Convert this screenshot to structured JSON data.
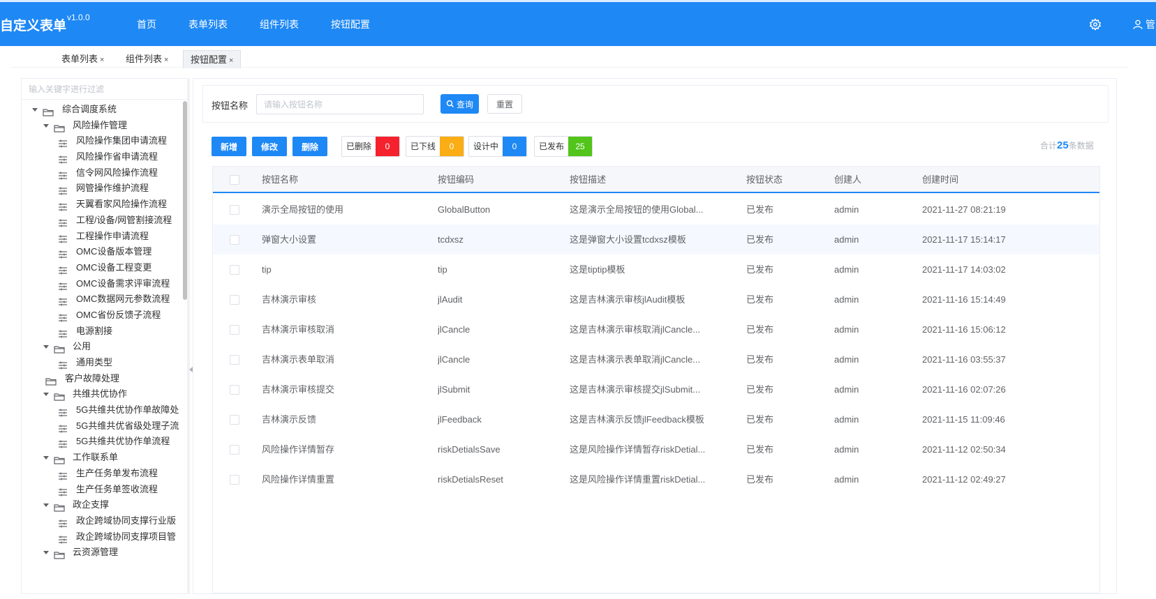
{
  "app": {
    "title": "自定义表单",
    "version": "v1.0.0"
  },
  "nav": [
    "首页",
    "表单列表",
    "组件列表",
    "按钮配置"
  ],
  "user": {
    "label": "管"
  },
  "tabs": [
    {
      "label": "表单列表",
      "close": "×"
    },
    {
      "label": "组件列表",
      "close": "×"
    },
    {
      "label": "按钮配置",
      "close": "×"
    }
  ],
  "sidebar": {
    "filter_placeholder": "输入关键字进行过滤",
    "tree": [
      {
        "label": "综合调度系统",
        "type": "folder",
        "level": 0,
        "caret": true
      },
      {
        "label": "风险操作管理",
        "type": "folder",
        "level": 1,
        "caret": true
      },
      {
        "label": "风险操作集团申请流程",
        "type": "leaf",
        "level": 2
      },
      {
        "label": "风险操作省申请流程",
        "type": "leaf",
        "level": 2
      },
      {
        "label": "信令网风险操作流程",
        "type": "leaf",
        "level": 2
      },
      {
        "label": "网管操作维护流程",
        "type": "leaf",
        "level": 2
      },
      {
        "label": "天翼看家风险操作流程",
        "type": "leaf",
        "level": 2
      },
      {
        "label": "工程/设备/网管割接流程",
        "type": "leaf",
        "level": 2
      },
      {
        "label": "工程操作申请流程",
        "type": "leaf",
        "level": 2
      },
      {
        "label": "OMC设备版本管理",
        "type": "leaf",
        "level": 2
      },
      {
        "label": "OMC设备工程变更",
        "type": "leaf",
        "level": 2
      },
      {
        "label": "OMC设备需求评审流程",
        "type": "leaf",
        "level": 2
      },
      {
        "label": "OMC数据网元参数流程",
        "type": "leaf",
        "level": 2
      },
      {
        "label": "OMC省份反馈子流程",
        "type": "leaf",
        "level": 2
      },
      {
        "label": "电源割接",
        "type": "leaf",
        "level": 2
      },
      {
        "label": "公用",
        "type": "folder",
        "level": 1,
        "caret": true
      },
      {
        "label": "通用类型",
        "type": "leaf",
        "level": 2
      },
      {
        "label": "客户故障处理",
        "type": "folder",
        "level": 1,
        "caret": false
      },
      {
        "label": "共维共优协作",
        "type": "folder",
        "level": 1,
        "caret": true
      },
      {
        "label": "5G共维共优协作单故障处",
        "type": "leaf",
        "level": 2
      },
      {
        "label": "5G共维共优省级处理子流",
        "type": "leaf",
        "level": 2
      },
      {
        "label": "5G共维共优协作单流程",
        "type": "leaf",
        "level": 2
      },
      {
        "label": "工作联系单",
        "type": "folder",
        "level": 1,
        "caret": true
      },
      {
        "label": "生产任务单发布流程",
        "type": "leaf",
        "level": 2
      },
      {
        "label": "生产任务单签收流程",
        "type": "leaf",
        "level": 2
      },
      {
        "label": "政企支撑",
        "type": "folder",
        "level": 1,
        "caret": true
      },
      {
        "label": "政企跨域协同支撑行业版",
        "type": "leaf",
        "level": 2
      },
      {
        "label": "政企跨域协同支撑项目管",
        "type": "leaf",
        "level": 2
      },
      {
        "label": "云资源管理",
        "type": "folder",
        "level": 1,
        "caret": true
      }
    ]
  },
  "search": {
    "label": "按钮名称",
    "placeholder": "请输入按钮名称",
    "query_label": "查询",
    "reset_label": "重置"
  },
  "toolbar": {
    "add_label": "新增",
    "edit_label": "修改",
    "delete_label": "删除"
  },
  "stats": [
    {
      "label": "已删除",
      "count": "0",
      "color": "#f5222d"
    },
    {
      "label": "已下线",
      "count": "0",
      "color": "#faad14"
    },
    {
      "label": "设计中",
      "count": "0",
      "color": "#1e88f5"
    },
    {
      "label": "已发布",
      "count": "25",
      "color": "#52c41a"
    }
  ],
  "total": {
    "prefix": "合计",
    "count": "25",
    "suffix": "条数据"
  },
  "table": {
    "columns": [
      "按钮名称",
      "按钮编码",
      "按钮描述",
      "按钮状态",
      "创建人",
      "创建时间"
    ],
    "rows": [
      [
        "演示全局按钮的使用",
        "GlobalButton",
        "这是演示全局按钮的使用Global...",
        "已发布",
        "admin",
        "2021-11-27 08:21:19"
      ],
      [
        "弹窗大小设置",
        "tcdxsz",
        "这是弹窗大小设置tcdxsz模板",
        "已发布",
        "admin",
        "2021-11-17 15:14:17"
      ],
      [
        "tip",
        "tip",
        "这是tiptip模板",
        "已发布",
        "admin",
        "2021-11-17 14:03:02"
      ],
      [
        "吉林演示审核",
        "jlAudit",
        "这是吉林演示审核jlAudit模板",
        "已发布",
        "admin",
        "2021-11-16 15:14:49"
      ],
      [
        "吉林演示审核取消",
        "jlCancle",
        "这是吉林演示审核取消jlCancle...",
        "已发布",
        "admin",
        "2021-11-16 15:06:12"
      ],
      [
        "吉林演示表单取消",
        "jlCancle",
        "这是吉林演示表单取消jlCancle...",
        "已发布",
        "admin",
        "2021-11-16 03:55:37"
      ],
      [
        "吉林演示审核提交",
        "jlSubmit",
        "这是吉林演示审核提交jlSubmit...",
        "已发布",
        "admin",
        "2021-11-16 02:07:26"
      ],
      [
        "吉林演示反馈",
        "jlFeedback",
        "这是吉林演示反馈jlFeedback模板",
        "已发布",
        "admin",
        "2021-11-15 11:09:46"
      ],
      [
        "风险操作详情暂存",
        "riskDetialsSave",
        "这是风险操作详情暂存riskDetial...",
        "已发布",
        "admin",
        "2021-11-12 02:50:34"
      ],
      [
        "风险操作详情重置",
        "riskDetialsReset",
        "这是风险操作详情重置riskDetial...",
        "已发布",
        "admin",
        "2021-11-12 02:49:27"
      ]
    ]
  }
}
